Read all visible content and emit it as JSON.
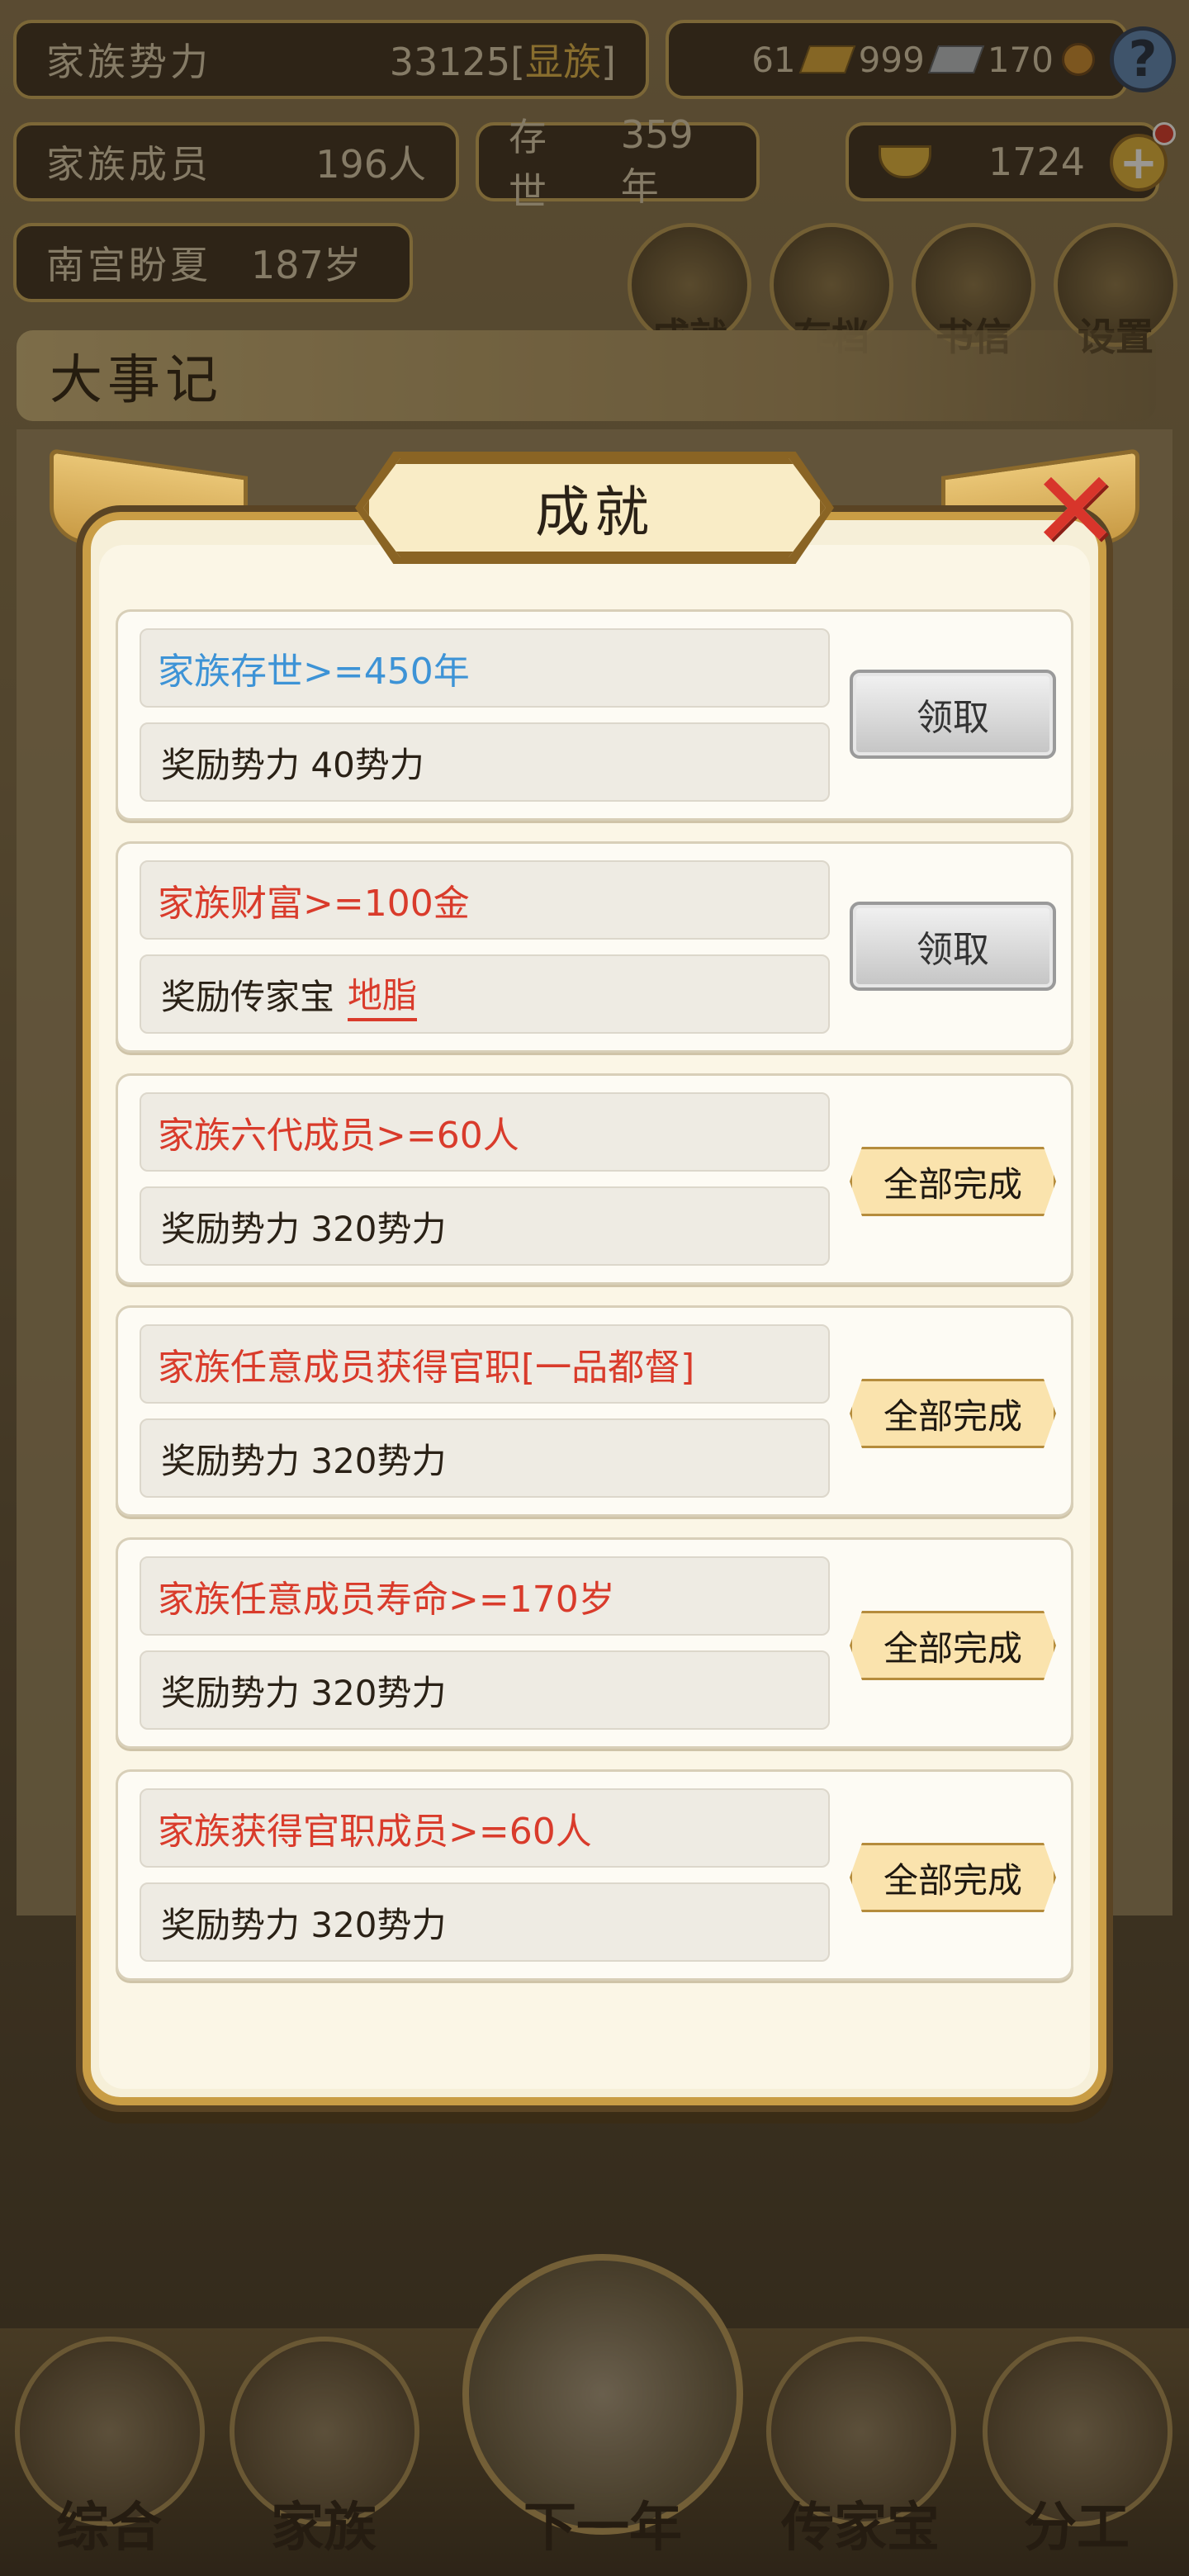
{
  "header": {
    "power_label": "家族势力",
    "power_value": "33125",
    "power_rank_open": "[",
    "power_rank": "显族",
    "power_rank_close": "]",
    "currency_a": "61",
    "currency_b": "999",
    "currency_c": "170",
    "members_label": "家族成员",
    "members_value": "196人",
    "exist_label": "存世",
    "exist_value": "359年",
    "gold_value": "1724",
    "person_name": "南宫盼夏",
    "person_age": "187岁"
  },
  "menu_buttons": [
    {
      "label": "成就"
    },
    {
      "label": "存档"
    },
    {
      "label": "书信"
    },
    {
      "label": "设置"
    }
  ],
  "events_title": "大事记",
  "bottom_nav": [
    {
      "label": "综合"
    },
    {
      "label": "家族"
    },
    {
      "label": "下一年"
    },
    {
      "label": "传家宝"
    },
    {
      "label": "分工"
    }
  ],
  "modal": {
    "title": "成就",
    "achievements": [
      {
        "goal": "家族存世>=450年",
        "goal_color": "#3d93d6",
        "reward_prefix": "奖励势力 40势力",
        "reward_item": "",
        "action": "领取",
        "status": "claimable"
      },
      {
        "goal": "家族财富>=100金",
        "goal_color": "#d93b2b",
        "reward_prefix": "奖励传家宝",
        "reward_item": "地脂",
        "action": "领取",
        "status": "claimable"
      },
      {
        "goal": "家族六代成员>=60人",
        "goal_color": "#d93b2b",
        "reward_prefix": "奖励势力 320势力",
        "reward_item": "",
        "action": "全部完成",
        "status": "done"
      },
      {
        "goal": "家族任意成员获得官职[一品都督]",
        "goal_color": "#d93b2b",
        "reward_prefix": "奖励势力 320势力",
        "reward_item": "",
        "action": "全部完成",
        "status": "done"
      },
      {
        "goal": "家族任意成员寿命>=170岁",
        "goal_color": "#d93b2b",
        "reward_prefix": "奖励势力 320势力",
        "reward_item": "",
        "action": "全部完成",
        "status": "done"
      },
      {
        "goal": "家族获得官职成员>=60人",
        "goal_color": "#d93b2b",
        "reward_prefix": "奖励势力 320势力",
        "reward_item": "",
        "action": "全部完成",
        "status": "done"
      }
    ]
  }
}
